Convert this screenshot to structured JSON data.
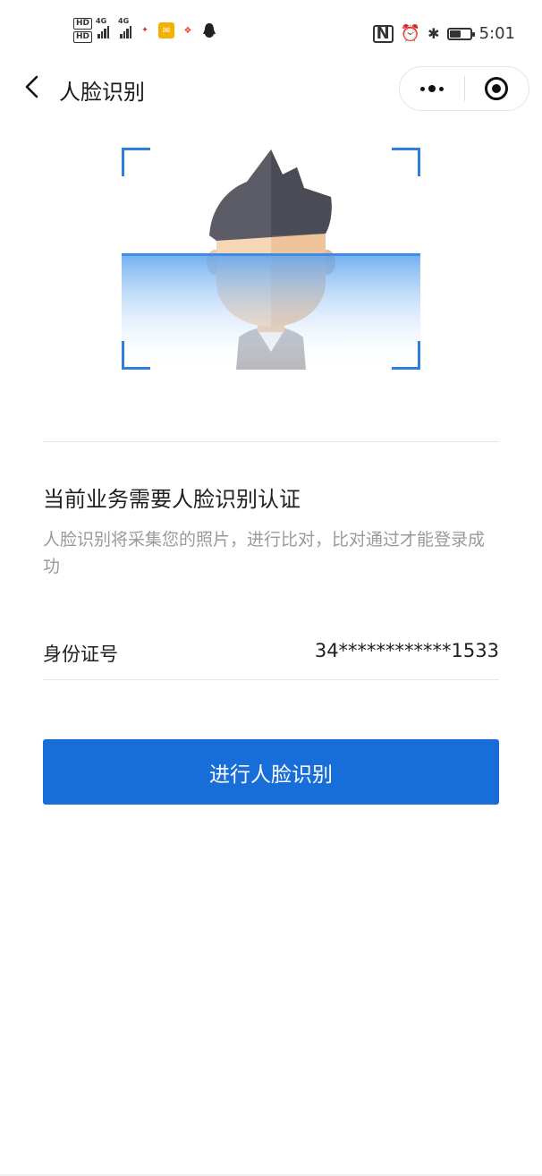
{
  "status_bar": {
    "hd1": "HD",
    "hd2": "HD",
    "net1": "4G",
    "net2": "4G",
    "time": "5:01",
    "icons": [
      "nfc-icon",
      "alarm-icon",
      "bluetooth-icon",
      "battery-icon"
    ],
    "battery_level": 0.5
  },
  "nav": {
    "title": "人脸识别",
    "back_icon": "chevron-left-icon",
    "menu_icon": "more-dots-icon",
    "close_icon": "target-circle-icon"
  },
  "illustration": {
    "frame_color": "#2f7de1",
    "scan_color": "#3d8ce8"
  },
  "content": {
    "title": "当前业务需要人脸识别认证",
    "description": "人脸识别将采集您的照片，进行比对，比对通过才能登录成功"
  },
  "id_row": {
    "label": "身份证号",
    "value": "34************1533"
  },
  "action": {
    "button_label": "进行人脸识别",
    "button_color": "#176ed8"
  }
}
